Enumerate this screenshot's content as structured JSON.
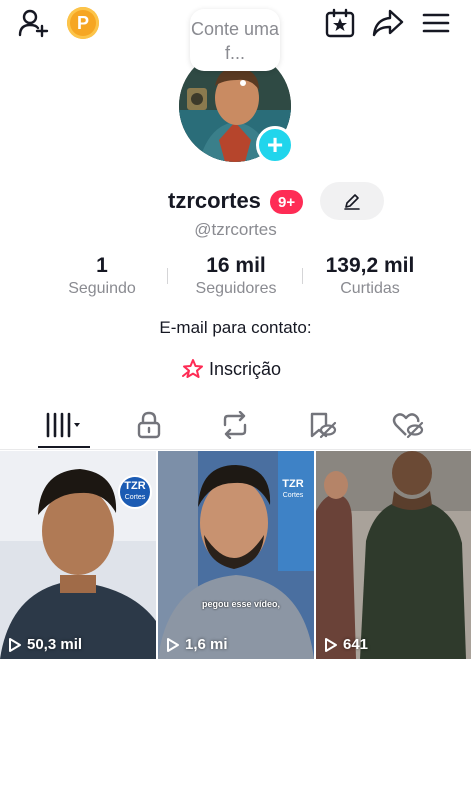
{
  "header": {
    "add_friend_icon": "person-plus-icon",
    "points_icon": "points-coin-icon",
    "points_letter": "P",
    "calendar_icon": "calendar-star-icon",
    "share_icon": "share-arrow-icon",
    "menu_icon": "hamburger-menu-icon"
  },
  "profile": {
    "note_text": "Conte uma f...",
    "username": "tzrcortes",
    "notification_badge": "9+",
    "handle": "@tzrcortes",
    "add_photo_symbol": "+"
  },
  "stats": [
    {
      "value": "1",
      "label": "Seguindo"
    },
    {
      "value": "16 mil",
      "label": "Seguidores"
    },
    {
      "value": "139,2 mil",
      "label": "Curtidas"
    }
  ],
  "contact": {
    "email_label": "E-mail para contato:",
    "subscription_label": "Inscrição"
  },
  "tabs": [
    {
      "icon": "videos-grid-icon",
      "active": true
    },
    {
      "icon": "lock-icon",
      "active": false
    },
    {
      "icon": "repost-icon",
      "active": false
    },
    {
      "icon": "bookmark-hidden-icon",
      "active": false
    },
    {
      "icon": "liked-hidden-icon",
      "active": false
    }
  ],
  "videos": [
    {
      "views": "50,3 mil",
      "logo_text": "TZR",
      "logo_sub": "Cortes"
    },
    {
      "views": "1,6 mi",
      "logo_text": "TZR",
      "logo_sub": "Cortes",
      "caption": "pegou esse vídeo,"
    },
    {
      "views": "641"
    }
  ],
  "colors": {
    "accent_red": "#fe2c55",
    "accent_cyan": "#20d5ec",
    "text_primary": "#161823",
    "text_secondary": "#8a8b91",
    "points_gold": "#f6a623"
  }
}
